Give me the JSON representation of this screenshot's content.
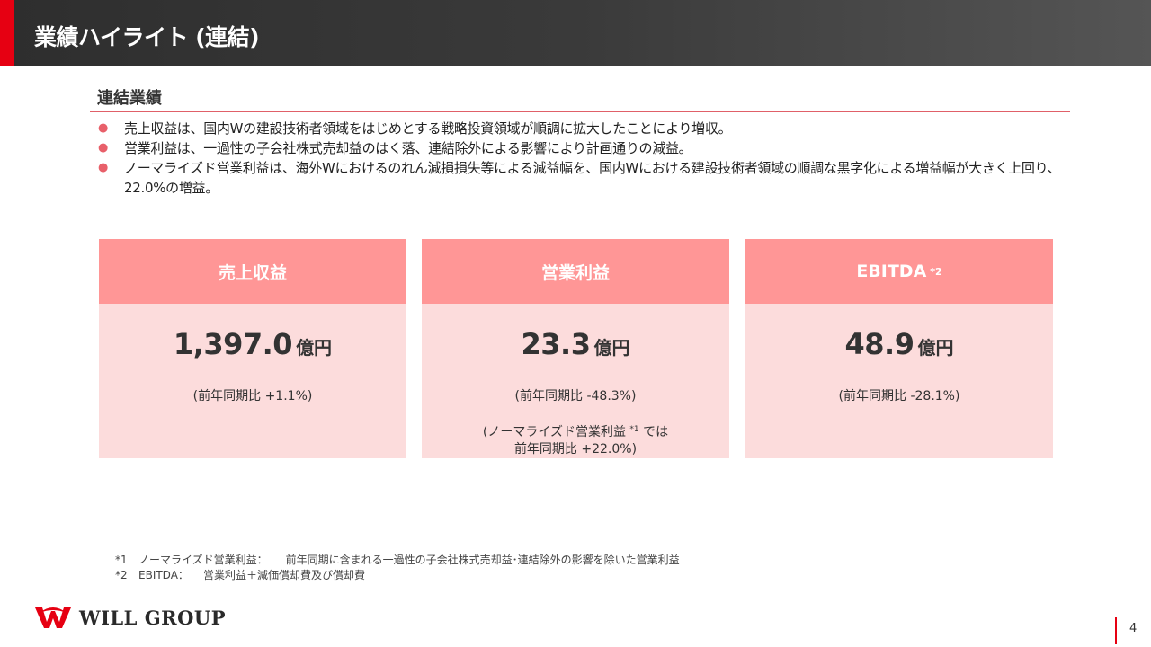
{
  "header": {
    "title": "業績ハイライト (連結)"
  },
  "section": {
    "heading": "連結業績",
    "bullets": [
      "売上収益は、国内Wの建設技術者領域をはじめとする戦略投資領域が順調に拡大したことにより増収。",
      "営業利益は、一過性の子会社株式売却益のはく落、連結除外による影響により計画通りの減益。",
      "ノーマライズド営業利益は、海外Wにおけるのれん減損損失等による減益幅を、国内Wにおける建設技術者領域の順調な黒字化による増益幅が大きく上回り、22.0%の増益。"
    ]
  },
  "cards": [
    {
      "label": "売上収益",
      "value": "1,397.0",
      "unit": "億円",
      "yoy": "(前年同期比 +1.1%)"
    },
    {
      "label": "営業利益",
      "value": "23.3",
      "unit": "億円",
      "yoy": "(前年同期比 -48.3%)",
      "note_line1a": "(ノーマライズド営業利益",
      "note_sup": "*1",
      "note_line1b": " では",
      "note_line2": "前年同期比 +22.0%)"
    },
    {
      "label": "EBITDA",
      "label_sup": "*2",
      "value": "48.9",
      "unit": "億円",
      "yoy": "(前年同期比 -28.1%)"
    }
  ],
  "footnotes": [
    {
      "mark": "*1",
      "label": "ノーマライズド営業利益：",
      "text": "前年同期に含まれる一過性の子会社株式売却益･連結除外の影響を除いた営業利益"
    },
    {
      "mark": "*2",
      "label": "EBITDA：",
      "text": "営業利益＋減価償却費及び償却費"
    }
  ],
  "footer": {
    "logo_text": "WILL GROUP",
    "logo_icon": "will-group-logo-icon",
    "page_number": "4"
  },
  "colors": {
    "accent": "#e60012",
    "card_header": "#ff9696",
    "card_body": "#fcdcdc",
    "bullet": "#e8606a"
  }
}
